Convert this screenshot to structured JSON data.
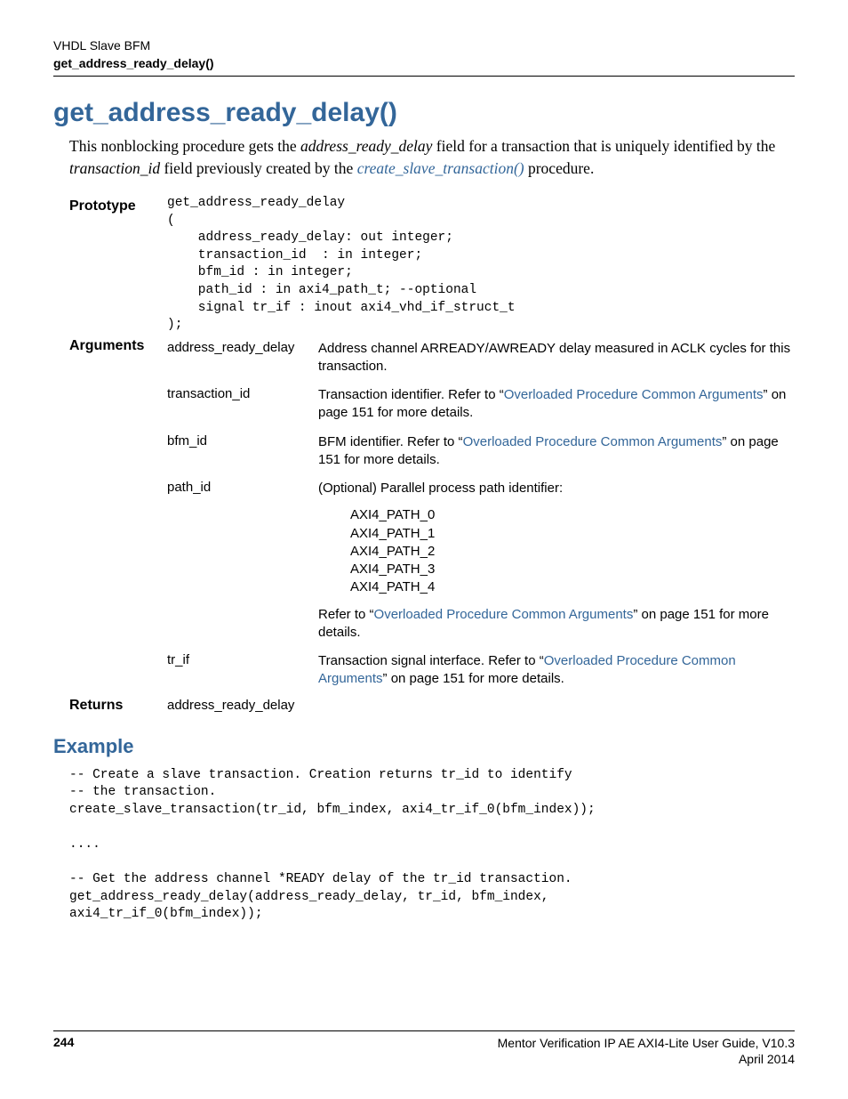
{
  "header": {
    "line1": "VHDL Slave BFM",
    "line2": "get_address_ready_delay()"
  },
  "title": "get_address_ready_delay()",
  "intro": {
    "t1": "This nonblocking procedure gets the ",
    "i1": "address_ready_delay",
    "t2": " field for a transaction that is uniquely identified by the ",
    "i2": "transaction_id",
    "t3": " field previously created by the ",
    "link": "create_slave_transaction()",
    "t4": " procedure."
  },
  "labels": {
    "prototype": "Prototype",
    "arguments": "Arguments",
    "returns": "Returns"
  },
  "prototype_code": "get_address_ready_delay\n(\n    address_ready_delay: out integer;\n    transaction_id  : in integer;\n    bfm_id : in integer;\n    path_id : in axi4_path_t; --optional\n    signal tr_if : inout axi4_vhd_if_struct_t\n);",
  "args": {
    "a1": {
      "name": "address_ready_delay",
      "desc": "Address channel ARREADY/AWREADY delay measured in ACLK cycles for this transaction."
    },
    "a2": {
      "name": "transaction_id",
      "pre": "Transaction identifier. Refer to “",
      "link": "Overloaded Procedure Common Arguments",
      "post": "” on page 151 for more details."
    },
    "a3": {
      "name": "bfm_id",
      "pre": "BFM identifier. Refer to “",
      "link": "Overloaded Procedure Common Arguments",
      "post": "” on page 151 for more details."
    },
    "a4": {
      "name": "path_id",
      "intro": "(Optional) Parallel process path identifier:",
      "paths": "AXI4_PATH_0\nAXI4_PATH_1\nAXI4_PATH_2\nAXI4_PATH_3\nAXI4_PATH_4",
      "afterPre": "Refer to “",
      "link": "Overloaded Procedure Common Arguments",
      "afterPost": "” on page 151 for more details."
    },
    "a5": {
      "name": "tr_if",
      "pre": "Transaction signal interface. Refer to “",
      "link": "Overloaded Procedure Common Arguments",
      "post": "” on page 151 for more details."
    }
  },
  "returns": "address_ready_delay",
  "example_title": "Example",
  "example_code": "-- Create a slave transaction. Creation returns tr_id to identify\n-- the transaction.\ncreate_slave_transaction(tr_id, bfm_index, axi4_tr_if_0(bfm_index));\n\n....\n\n-- Get the address channel *READY delay of the tr_id transaction.\nget_address_ready_delay(address_ready_delay, tr_id, bfm_index,\naxi4_tr_if_0(bfm_index));",
  "footer": {
    "page": "244",
    "guide": "Mentor Verification IP AE AXI4-Lite User Guide, V10.3",
    "date": "April 2014"
  }
}
